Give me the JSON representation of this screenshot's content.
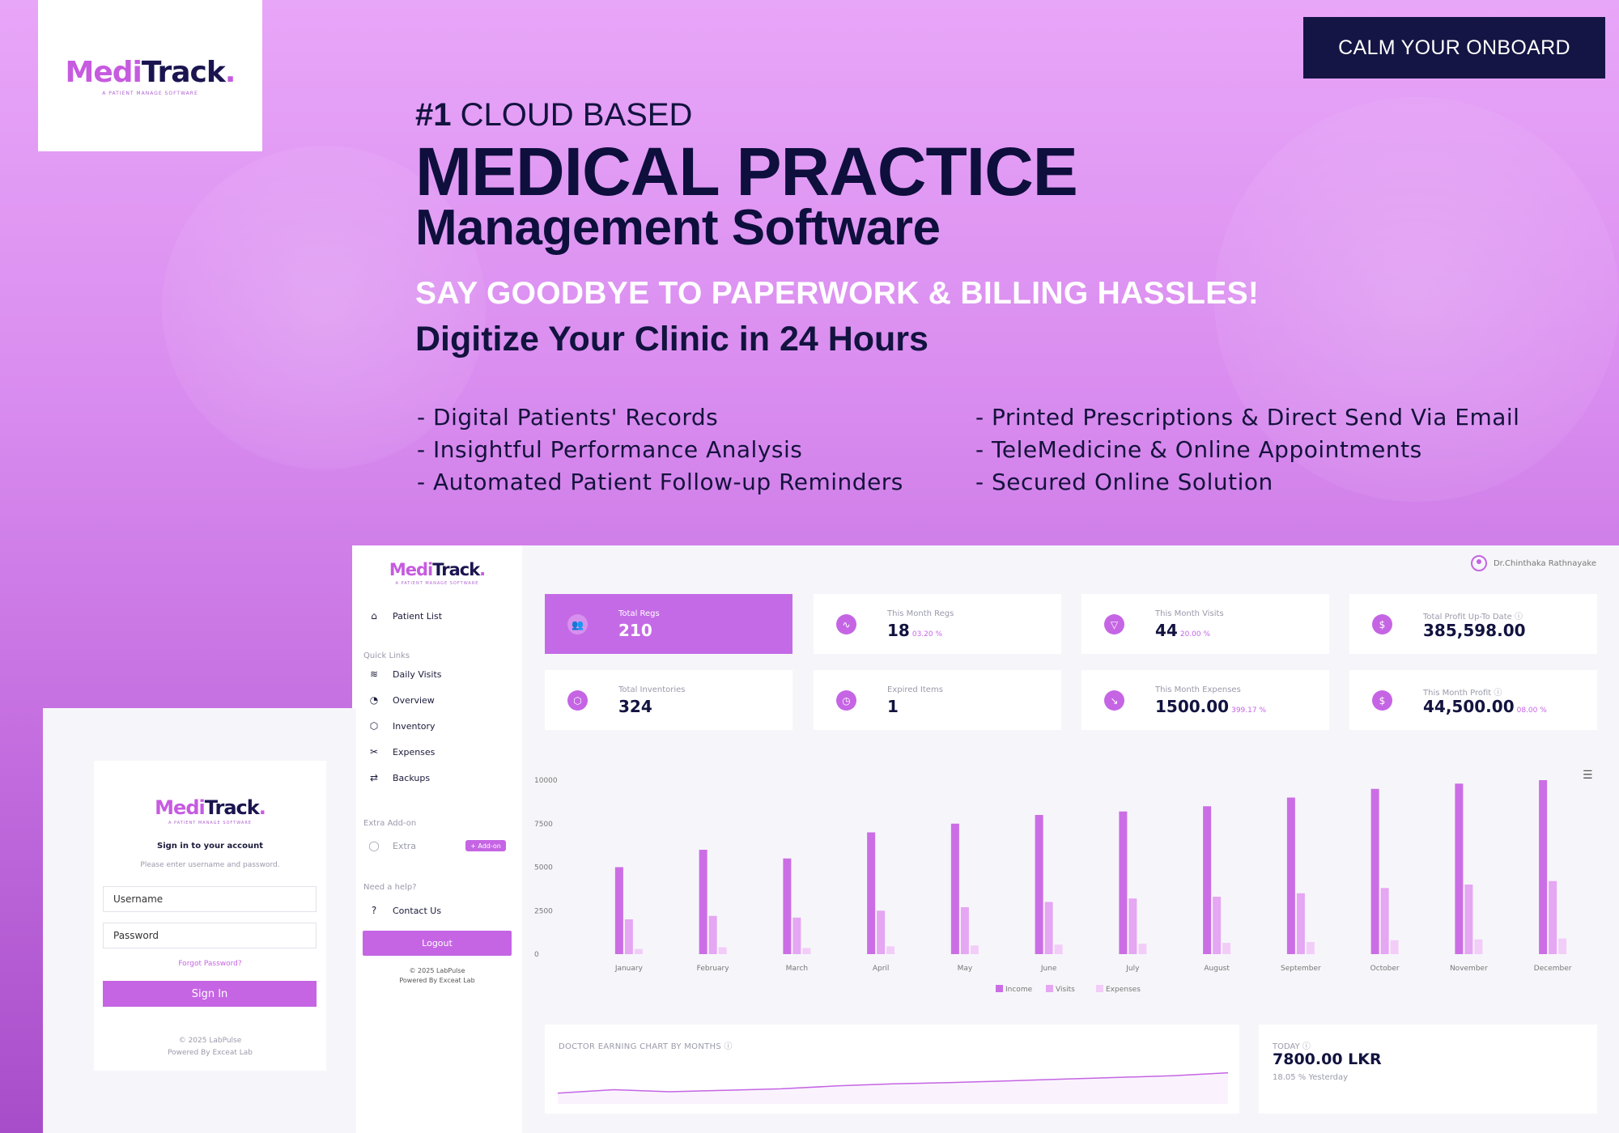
{
  "brand": {
    "logo_medi": "Medi",
    "logo_track": "Track",
    "logo_dot": ".",
    "tagline": "A PATIENT MANAGE SOFTWARE"
  },
  "cta": {
    "label": "CALM YOUR ONBOARD"
  },
  "hero": {
    "rank": "#1",
    "line1": "CLOUD BASED",
    "line2": "MEDICAL PRACTICE",
    "line3": "Management Software",
    "line4": "SAY GOODBYE TO PAPERWORK & BILLING HASSLES!",
    "line5": "Digitize Your Clinic in 24 Hours"
  },
  "features": {
    "left": [
      "- Digital Patients' Records",
      "- Insightful Performance Analysis",
      "- Automated Patient Follow-up Reminders"
    ],
    "right": [
      "- Printed Prescriptions & Direct Send Via Email",
      "- TeleMedicine & Online Appointments",
      "- Secured Online Solution"
    ]
  },
  "sidebar": {
    "patient_list": "Patient List",
    "quick_links_head": "Quick Links",
    "quick_links": [
      "Daily Visits",
      "Overview",
      "Inventory",
      "Expenses",
      "Backups"
    ],
    "extra_head": "Extra Add-on",
    "extra_item": "Extra",
    "addon_badge": "+ Add-on",
    "help_head": "Need a help?",
    "contact": "Contact Us",
    "logout": "Logout",
    "copyright": "© 2025 LabPulse",
    "powered": "Powered By Exceat Lab"
  },
  "user": {
    "name": "Dr.Chinthaka Rathnayake"
  },
  "cards": [
    {
      "label": "Total Regs",
      "value": "210",
      "pct": "",
      "icon": "users-icon",
      "glyph": "👥"
    },
    {
      "label": "This Month Regs",
      "value": "18",
      "pct": "03.20 %",
      "icon": "activity-icon",
      "glyph": "∿"
    },
    {
      "label": "This Month Visits",
      "value": "44",
      "pct": "20.00 %",
      "icon": "filter-icon",
      "glyph": "▽"
    },
    {
      "label": "Total Profit Up-To Date ⓘ",
      "value": "385,598.00",
      "pct": "",
      "icon": "dollar-icon",
      "glyph": "$"
    },
    {
      "label": "Total Inventories",
      "value": "324",
      "pct": "",
      "icon": "box-icon",
      "glyph": "⬡"
    },
    {
      "label": "Expired Items",
      "value": "1",
      "pct": "",
      "icon": "clock-icon",
      "glyph": "◷"
    },
    {
      "label": "This Month Expenses",
      "value": "1500.00",
      "pct": "399.17 %",
      "icon": "arrow-down-right-icon",
      "glyph": "↘"
    },
    {
      "label": "This Month Profit ⓘ",
      "value": "44,500.00",
      "pct": "08.00 %",
      "icon": "dollar-icon",
      "glyph": "$"
    }
  ],
  "chart_data": [
    {
      "type": "bar",
      "categories": [
        "January",
        "February",
        "March",
        "April",
        "May",
        "June",
        "July",
        "August",
        "September",
        "October",
        "November",
        "December"
      ],
      "series": [
        {
          "name": "Income",
          "values": [
            5000,
            6000,
            5500,
            7000,
            7500,
            8000,
            8200,
            8500,
            9000,
            9500,
            9800,
            10000
          ],
          "color": "#cb6ee5"
        },
        {
          "name": "Visits",
          "values": [
            2000,
            2200,
            2100,
            2500,
            2700,
            3000,
            3200,
            3300,
            3500,
            3800,
            4000,
            4200
          ],
          "color": "#e5a6f3"
        },
        {
          "name": "Expenses",
          "values": [
            300,
            400,
            350,
            450,
            500,
            550,
            600,
            650,
            700,
            800,
            850,
            900
          ],
          "color": "#f2cdf8"
        }
      ],
      "yticks": [
        "0",
        "2500",
        "5000",
        "7500",
        "10000"
      ],
      "ylim": [
        0,
        10000
      ],
      "legend": "bottom-center",
      "grid": false
    },
    {
      "type": "area",
      "title": "DOCTOR EARNING CHART BY MONTHS ⓘ",
      "values": [
        0.2,
        0.32,
        0.25,
        0.3,
        0.35,
        0.45,
        0.52,
        0.56,
        0.62,
        0.68,
        0.74,
        0.8,
        0.9
      ],
      "color": "#c565e4"
    }
  ],
  "today": {
    "label": "TODAY ⓘ",
    "value": "7800.00 LKR",
    "sub": "18.05 % Yesterday"
  },
  "login": {
    "title": "Sign in to your account",
    "subtitle": "Please enter username and password.",
    "username_placeholder": "Username",
    "password_placeholder": "Password",
    "forgot": "Forgot Password?",
    "sign_in": "Sign In",
    "copyright": "© 2025 LabPulse",
    "powered": "Powered By Exceat Lab"
  }
}
